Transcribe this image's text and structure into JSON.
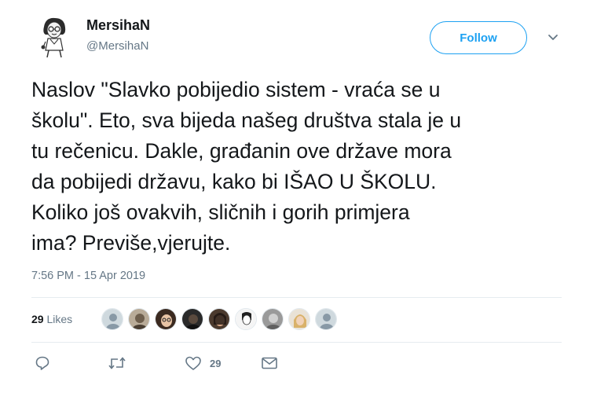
{
  "user": {
    "name": "MersihaN",
    "handle": "@MersihaN"
  },
  "follow_label": "Follow",
  "tweet": {
    "text": "Naslov \"Slavko pobijedio sistem - vraća se u\nškolu\". Eto, sva bijeda našeg društva stala je u\ntu rečenicu. Dakle, građanin ove države mora\nda pobijedi državu, kako bi IŠAO U ŠKOLU.\nKoliko još ovakvih, sličnih i gorih primjera\nima? Previše,vjerujte.",
    "timestamp": "7:56 PM - 15 Apr 2019"
  },
  "likes": {
    "count": "29",
    "label": "Likes"
  },
  "likers": [
    {
      "style": "default"
    },
    {
      "style": "sepia"
    },
    {
      "style": "woman-glasses"
    },
    {
      "style": "dark"
    },
    {
      "style": "woman-dark"
    },
    {
      "style": "sketch"
    },
    {
      "style": "grey-photo"
    },
    {
      "style": "blonde"
    },
    {
      "style": "default"
    }
  ],
  "actions": {
    "reply_icon": "reply-icon",
    "retweet_icon": "retweet-icon",
    "like_icon": "heart-icon",
    "like_count": "29",
    "dm_icon": "envelope-icon"
  },
  "colors": {
    "accent": "#1da1f2",
    "text": "#14171a",
    "secondary": "#657786",
    "divider": "#e6ecf0"
  }
}
